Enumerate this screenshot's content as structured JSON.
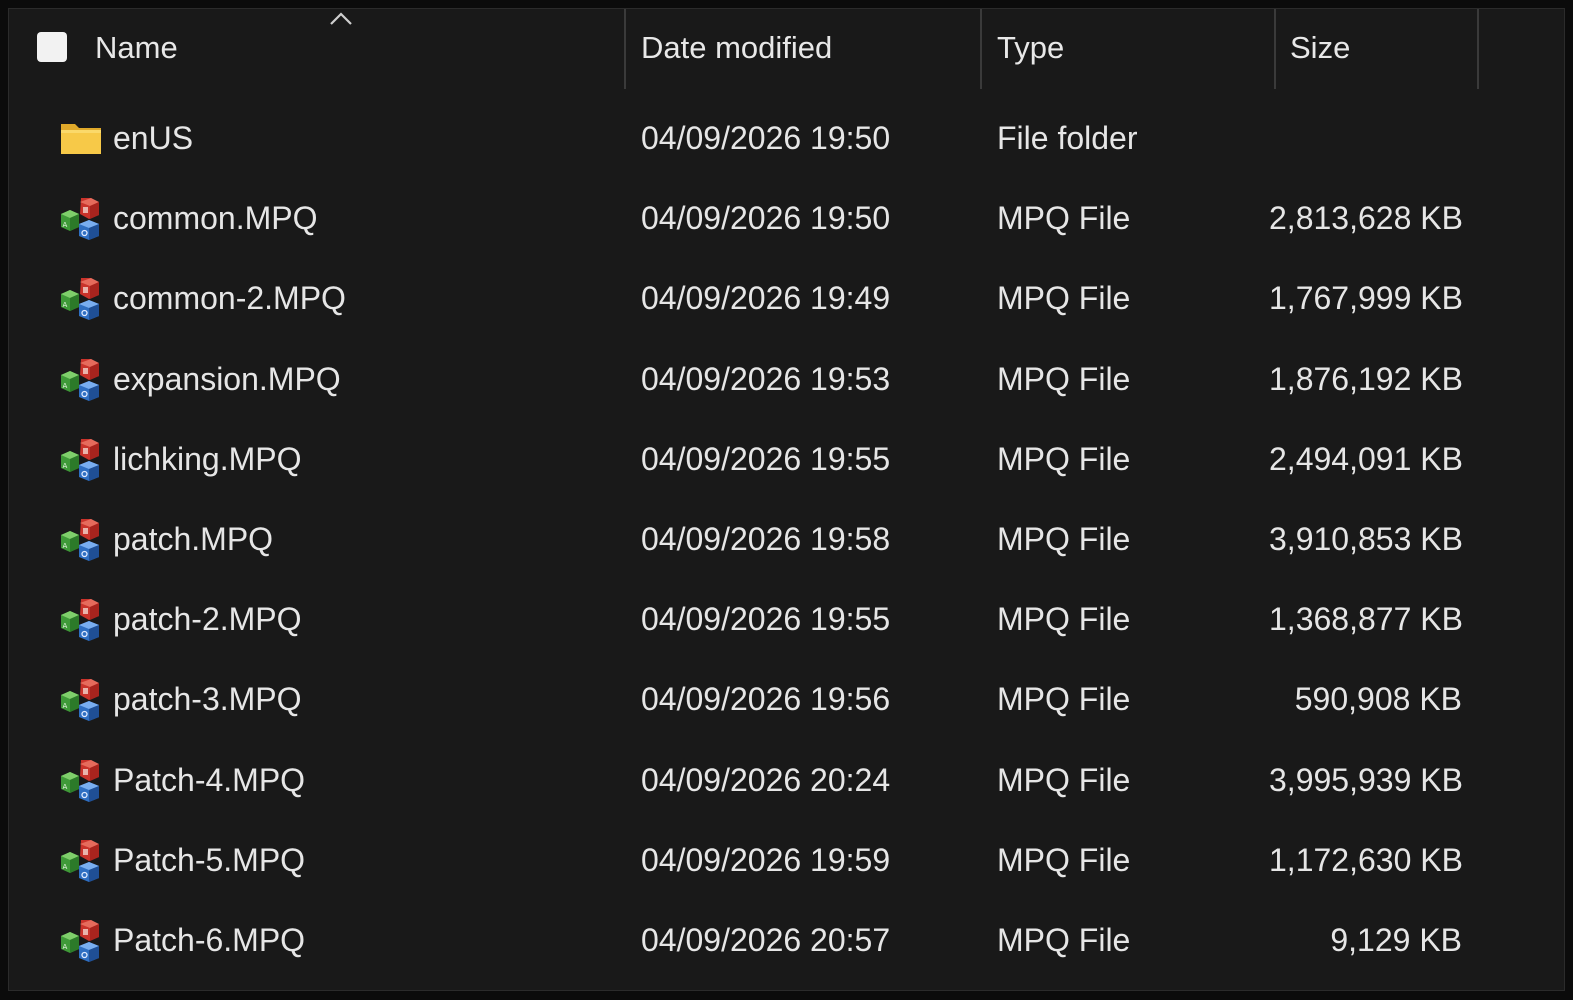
{
  "header": {
    "name": "Name",
    "date_modified": "Date modified",
    "type": "Type",
    "size": "Size",
    "sort_icon": "chevron-up-icon"
  },
  "colors": {
    "background": "#191919",
    "text": "#e6e6e6",
    "divider": "#3a3a3a",
    "folder": "#f5c542"
  },
  "files": [
    {
      "name": "enUS",
      "date": "04/09/2026 19:50",
      "type": "File folder",
      "size": "",
      "icon": "folder-icon"
    },
    {
      "name": "common.MPQ",
      "date": "04/09/2026 19:50",
      "type": "MPQ File",
      "size": "2,813,628 KB",
      "icon": "mpq-file-icon"
    },
    {
      "name": "common-2.MPQ",
      "date": "04/09/2026 19:49",
      "type": "MPQ File",
      "size": "1,767,999 KB",
      "icon": "mpq-file-icon"
    },
    {
      "name": "expansion.MPQ",
      "date": "04/09/2026 19:53",
      "type": "MPQ File",
      "size": "1,876,192 KB",
      "icon": "mpq-file-icon"
    },
    {
      "name": "lichking.MPQ",
      "date": "04/09/2026 19:55",
      "type": "MPQ File",
      "size": "2,494,091 KB",
      "icon": "mpq-file-icon"
    },
    {
      "name": "patch.MPQ",
      "date": "04/09/2026 19:58",
      "type": "MPQ File",
      "size": "3,910,853 KB",
      "icon": "mpq-file-icon"
    },
    {
      "name": "patch-2.MPQ",
      "date": "04/09/2026 19:55",
      "type": "MPQ File",
      "size": "1,368,877 KB",
      "icon": "mpq-file-icon"
    },
    {
      "name": "patch-3.MPQ",
      "date": "04/09/2026 19:56",
      "type": "MPQ File",
      "size": "590,908 KB",
      "icon": "mpq-file-icon"
    },
    {
      "name": "Patch-4.MPQ",
      "date": "04/09/2026 20:24",
      "type": "MPQ File",
      "size": "3,995,939 KB",
      "icon": "mpq-file-icon"
    },
    {
      "name": "Patch-5.MPQ",
      "date": "04/09/2026 19:59",
      "type": "MPQ File",
      "size": "1,172,630 KB",
      "icon": "mpq-file-icon"
    },
    {
      "name": "Patch-6.MPQ",
      "date": "04/09/2026 20:57",
      "type": "MPQ File",
      "size": "9,129 KB",
      "icon": "mpq-file-icon"
    }
  ]
}
